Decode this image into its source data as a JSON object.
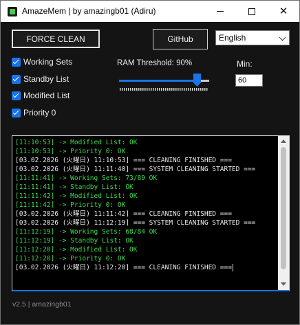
{
  "window": {
    "title": "AmazeMem | by amazingb01 (Adiru)",
    "minimize_glyph": "",
    "close_glyph": "✕"
  },
  "toolbar": {
    "force_clean_label": "FORCE CLEAN",
    "github_label": "GitHub",
    "language_selected": "English"
  },
  "options": [
    {
      "label": "Working Sets",
      "checked": true
    },
    {
      "label": "Standby List",
      "checked": true
    },
    {
      "label": "Modified List",
      "checked": true
    },
    {
      "label": "Priority 0",
      "checked": true
    }
  ],
  "threshold": {
    "label": "RAM Threshold: 90%",
    "value_percent": 90
  },
  "min": {
    "label": "Min:",
    "value": "60"
  },
  "log": {
    "lines": [
      {
        "text": "[11:10:53] -> Modified List: OK",
        "kind": "step"
      },
      {
        "text": "[11:10:53] -> Priority 0: OK",
        "kind": "step"
      },
      {
        "text": "[03.02.2026 (火曜日) 11:10:53] === CLEANING FINISHED ===",
        "kind": "event"
      },
      {
        "text": "[03.02.2026 (火曜日) 11:11:40] === SYSTEM CLEANING STARTED ===",
        "kind": "event"
      },
      {
        "text": "[11:11:41] -> Working Sets: 73/89 OK",
        "kind": "step"
      },
      {
        "text": "[11:11:41] -> Standby List: OK",
        "kind": "step"
      },
      {
        "text": "[11:11:42] -> Modified List: OK",
        "kind": "step"
      },
      {
        "text": "[11:11:42] -> Priority 0: OK",
        "kind": "step"
      },
      {
        "text": "[03.02.2026 (火曜日) 11:11:42] === CLEANING FINISHED ===",
        "kind": "event"
      },
      {
        "text": "[03.02.2026 (火曜日) 11:12:19] === SYSTEM CLEANING STARTED ===",
        "kind": "event"
      },
      {
        "text": "[11:12:19] -> Working Sets: 68/84 OK",
        "kind": "step"
      },
      {
        "text": "[11:12:19] -> Standby List: OK",
        "kind": "step"
      },
      {
        "text": "[11:12:20] -> Modified List: OK",
        "kind": "step"
      },
      {
        "text": "[11:12:20] -> Priority 0: OK",
        "kind": "step"
      },
      {
        "text": "[03.02.2026 (火曜日) 11:12:20] === CLEANING FINISHED ===",
        "kind": "event"
      }
    ],
    "colors": {
      "step": "#3ddc4a",
      "event": "#e8e8e8"
    }
  },
  "footer": {
    "text": "v2.5 | amazingb01"
  }
}
